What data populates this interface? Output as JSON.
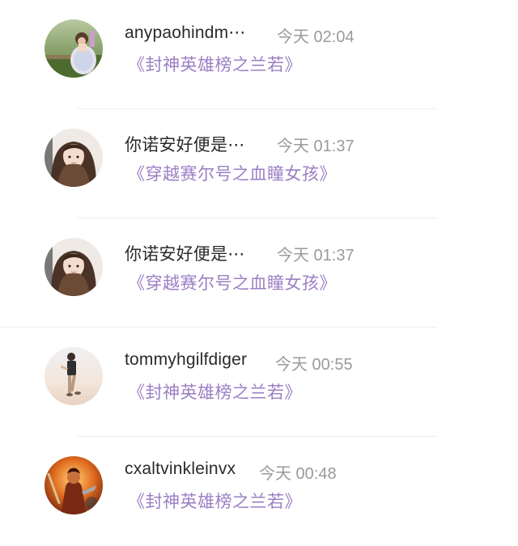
{
  "comments": [
    {
      "user": "anypaohindm⋯",
      "time": "今天 02:04",
      "book": "《封神英雄榜之兰若》",
      "avatar_icon": "avatar-girl-lawn-photo"
    },
    {
      "user": "你诺安好便是⋯",
      "time": "今天 01:37",
      "book": "《穿越赛尔号之血瞳女孩》",
      "avatar_icon": "avatar-long-hair-girl-photo"
    },
    {
      "user": "你诺安好便是⋯",
      "time": "今天 01:37",
      "book": "《穿越赛尔号之血瞳女孩》",
      "avatar_icon": "avatar-long-hair-girl-photo"
    },
    {
      "user": "tommyhgilfdiger",
      "time": "今天 00:55",
      "book": "《封神英雄榜之兰若》",
      "avatar_icon": "avatar-walking-man-photo"
    },
    {
      "user": "cxaltvinkleinvx",
      "time": "今天 00:48",
      "book": "《封神英雄榜之兰若》",
      "avatar_icon": "avatar-warrior-fire-art"
    }
  ],
  "colors": {
    "username": "#2a2a2a",
    "timestamp": "#9a9a9a",
    "book_title": "#9a7fc4",
    "divider": "#eeeeee"
  }
}
